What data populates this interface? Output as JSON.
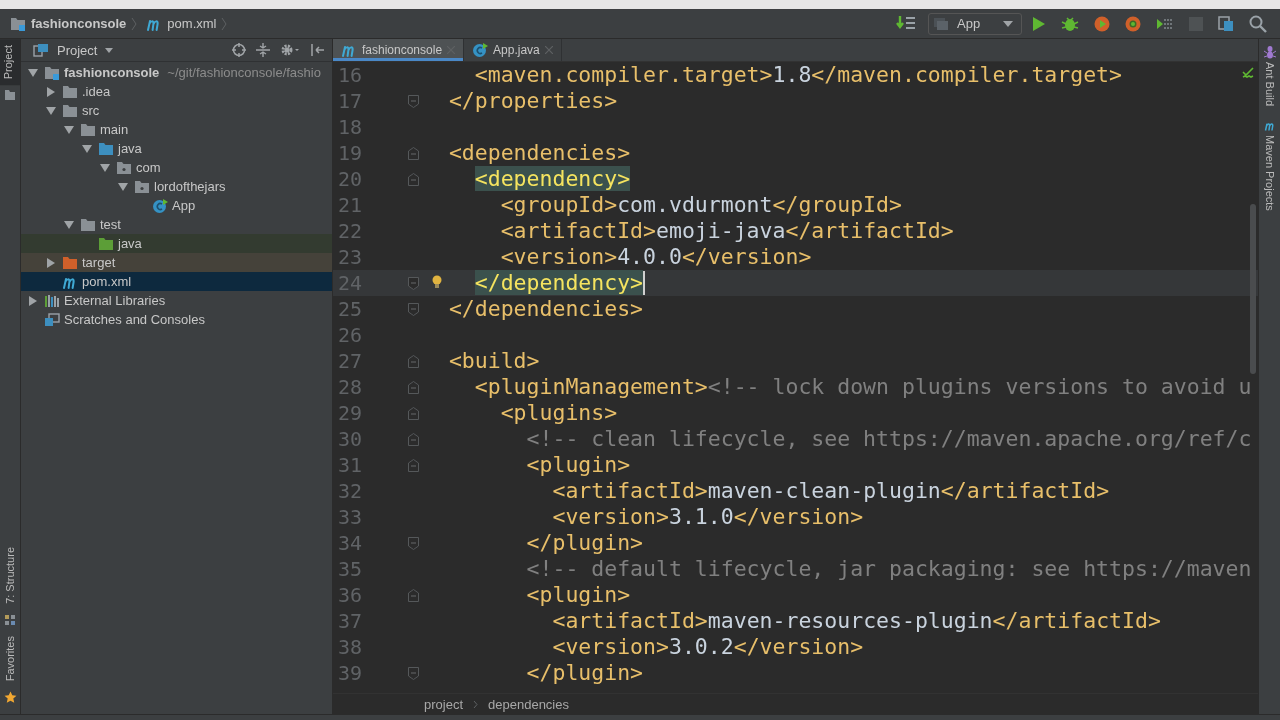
{
  "navbar": {
    "crumbs": [
      {
        "label": "fashionconsole",
        "kind": "module"
      },
      {
        "label": "pom.xml",
        "kind": "maven"
      }
    ]
  },
  "toolbar": {
    "run_config": "App"
  },
  "left_strip": {
    "top": [
      {
        "label": "Project",
        "selected": true
      }
    ],
    "bottom": [
      {
        "label": "7: Structure",
        "kind": "structure",
        "selected": false
      },
      {
        "label": "Favorites",
        "kind": "favorites",
        "selected": false
      }
    ]
  },
  "project_panel": {
    "title": "Project",
    "tree": [
      {
        "label": "fashionconsole",
        "kind": "module",
        "path": "~/git/fashionconsole/fashio",
        "expanded": true,
        "selected": false,
        "children": [
          {
            "label": ".idea",
            "kind": "folder",
            "expanded": false,
            "selected": false
          },
          {
            "label": "src",
            "kind": "folder",
            "expanded": true,
            "selected": false,
            "children": [
              {
                "label": "main",
                "kind": "folder",
                "expanded": true,
                "selected": false,
                "children": [
                  {
                    "label": "java",
                    "kind": "source",
                    "expanded": true,
                    "selected": false,
                    "children": [
                      {
                        "label": "com",
                        "kind": "package",
                        "expanded": true,
                        "selected": false,
                        "children": [
                          {
                            "label": "lordofthejars",
                            "kind": "package",
                            "expanded": true,
                            "selected": false,
                            "children": [
                              {
                                "label": "App",
                                "kind": "class",
                                "selected": false
                              }
                            ]
                          }
                        ]
                      }
                    ]
                  }
                ]
              },
              {
                "label": "test",
                "kind": "folder",
                "expanded": true,
                "selected": false,
                "children": [
                  {
                    "label": "java",
                    "kind": "test",
                    "selected": false
                  }
                ]
              }
            ]
          },
          {
            "label": "target",
            "kind": "excluded",
            "expanded": false,
            "selected": false
          },
          {
            "label": "pom.xml",
            "kind": "maven",
            "selected": true
          }
        ]
      },
      {
        "label": "External Libraries",
        "kind": "libraries",
        "expanded": false,
        "selected": false
      },
      {
        "label": "Scratches and Consoles",
        "kind": "scratches",
        "selected": false
      }
    ]
  },
  "editor": {
    "tabs": [
      {
        "label": "fashionconsole",
        "kind": "maven",
        "selected": true
      },
      {
        "label": "App.java",
        "kind": "class",
        "selected": false
      }
    ],
    "lines": [
      {
        "number": "16",
        "kind": "plain",
        "current": false,
        "segments": [
          {
            "kind": "tag",
            "text": "    <maven.compiler.target>"
          },
          {
            "kind": "text",
            "text": "1.8"
          },
          {
            "kind": "tag",
            "text": "</maven.compiler.target>"
          }
        ]
      },
      {
        "number": "17",
        "kind": "fold-end",
        "current": false,
        "segments": [
          {
            "kind": "tag",
            "text": "  </properties>"
          }
        ]
      },
      {
        "number": "18",
        "kind": "plain",
        "current": false
      },
      {
        "number": "19",
        "kind": "fold-start",
        "current": false,
        "segments": [
          {
            "kind": "tag",
            "text": "  <dependencies>"
          }
        ]
      },
      {
        "number": "20",
        "kind": "fold-start",
        "current": false,
        "segments": [
          {
            "kind": "match",
            "text": "    <dependency>"
          }
        ]
      },
      {
        "number": "21",
        "kind": "plain",
        "current": false,
        "segments": [
          {
            "kind": "tag",
            "text": "      <groupId>"
          },
          {
            "kind": "text",
            "text": "com.vdurmont"
          },
          {
            "kind": "tag",
            "text": "</groupId>"
          }
        ]
      },
      {
        "number": "22",
        "kind": "plain",
        "current": false,
        "segments": [
          {
            "kind": "tag",
            "text": "      <artifactId>"
          },
          {
            "kind": "text",
            "text": "emoji-java"
          },
          {
            "kind": "tag",
            "text": "</artifactId>"
          }
        ]
      },
      {
        "number": "23",
        "kind": "plain",
        "current": false,
        "segments": [
          {
            "kind": "tag",
            "text": "      <version>"
          },
          {
            "kind": "text",
            "text": "4.0.0"
          },
          {
            "kind": "tag",
            "text": "</version>"
          }
        ]
      },
      {
        "number": "24",
        "kind": "fold-end",
        "current": true,
        "bulb": true,
        "segments": [
          {
            "kind": "match",
            "text": "    </dependency>"
          }
        ]
      },
      {
        "number": "25",
        "kind": "fold-end",
        "current": false,
        "segments": [
          {
            "kind": "tag",
            "text": "  </dependencies>"
          }
        ]
      },
      {
        "number": "26",
        "kind": "plain",
        "current": false
      },
      {
        "number": "27",
        "kind": "fold-start",
        "current": false,
        "segments": [
          {
            "kind": "tag",
            "text": "  <build>"
          }
        ]
      },
      {
        "number": "28",
        "kind": "fold-start",
        "current": false,
        "segments": [
          {
            "kind": "tag",
            "text": "    <pluginManagement>"
          },
          {
            "kind": "comment",
            "text": "<!-- lock down plugins versions to avoid u"
          }
        ]
      },
      {
        "number": "29",
        "kind": "fold-start",
        "current": false,
        "segments": [
          {
            "kind": "tag",
            "text": "      <plugins>"
          }
        ]
      },
      {
        "number": "30",
        "kind": "fold-start",
        "current": false,
        "segments": [
          {
            "kind": "comment",
            "text": "        <!-- clean lifecycle, see https://maven.apache.org/ref/c"
          }
        ]
      },
      {
        "number": "31",
        "kind": "fold-start",
        "current": false,
        "segments": [
          {
            "kind": "tag",
            "text": "        <plugin>"
          }
        ]
      },
      {
        "number": "32",
        "kind": "plain",
        "current": false,
        "segments": [
          {
            "kind": "tag",
            "text": "          <artifactId>"
          },
          {
            "kind": "text",
            "text": "maven-clean-plugin"
          },
          {
            "kind": "tag",
            "text": "</artifactId>"
          }
        ]
      },
      {
        "number": "33",
        "kind": "plain",
        "current": false,
        "segments": [
          {
            "kind": "tag",
            "text": "          <version>"
          },
          {
            "kind": "text",
            "text": "3.1.0"
          },
          {
            "kind": "tag",
            "text": "</version>"
          }
        ]
      },
      {
        "number": "34",
        "kind": "fold-end",
        "current": false,
        "segments": [
          {
            "kind": "tag",
            "text": "        </plugin>"
          }
        ]
      },
      {
        "number": "35",
        "kind": "plain",
        "current": false,
        "segments": [
          {
            "kind": "comment",
            "text": "        <!-- default lifecycle, jar packaging: see https://maven"
          }
        ]
      },
      {
        "number": "36",
        "kind": "fold-start",
        "current": false,
        "segments": [
          {
            "kind": "tag",
            "text": "        <plugin>"
          }
        ]
      },
      {
        "number": "37",
        "kind": "plain",
        "current": false,
        "segments": [
          {
            "kind": "tag",
            "text": "          <artifactId>"
          },
          {
            "kind": "text",
            "text": "maven-resources-plugin"
          },
          {
            "kind": "tag",
            "text": "</artifactId>"
          }
        ]
      },
      {
        "number": "38",
        "kind": "plain",
        "current": false,
        "segments": [
          {
            "kind": "tag",
            "text": "          <version>"
          },
          {
            "kind": "text",
            "text": "3.0.2"
          },
          {
            "kind": "tag",
            "text": "</version>"
          }
        ]
      },
      {
        "number": "39",
        "kind": "fold-end",
        "current": false,
        "segments": [
          {
            "kind": "tag",
            "text": "        </plugin>"
          }
        ]
      }
    ],
    "breadcrumbs": [
      "project",
      "dependencies"
    ]
  },
  "right_strip": [
    {
      "label": "Ant Build",
      "kind": "ant"
    },
    {
      "label": "Maven Projects",
      "kind": "maven"
    }
  ]
}
